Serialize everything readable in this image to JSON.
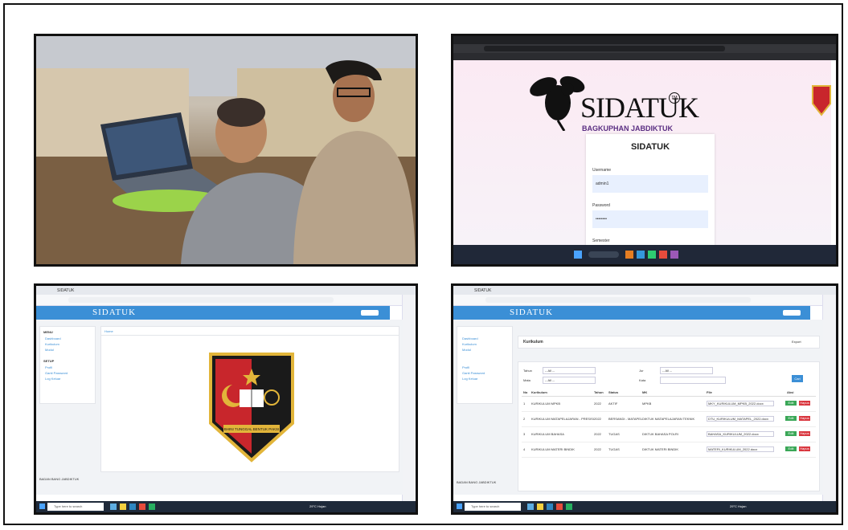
{
  "panel2": {
    "logo_text": "SIDATUK",
    "logo_tm": "TM",
    "tagline": "BAGKUPHAN JABDIKTUK",
    "login_title": "SIDATUK",
    "username_label": "Username",
    "username_value": "admin1",
    "password_label": "Password",
    "password_value": "••••••••",
    "extra_label": "Semester"
  },
  "panel3": {
    "tab_label": "SIDATUK",
    "brand": "SIDATUK",
    "menu_heading": "MENU",
    "menu_items": [
      "Dashboard",
      "Kurikulum",
      "Modul"
    ],
    "setup_heading": "SETUP",
    "setup_items": [
      "Profil",
      "Ganti Password",
      "Log Keluar"
    ],
    "breadcrumb": "Home",
    "emblem_banner": "BHINI TUNGGAL BENTUK PAKSI",
    "footer_text": "BADAN BANG JABDIKTUK",
    "taskbar_search": "Type here to search",
    "weather": "29°C Hujan"
  },
  "panel4": {
    "tab_label": "SIDATUK",
    "brand": "SIDATUK",
    "section_title": "Kurikulum",
    "export_label": "Export",
    "filter_labels": [
      "Tahun",
      "Mata",
      "Jur",
      "Kata"
    ],
    "filter_select": "-- All --",
    "search_button": "Cari",
    "columns": [
      "No",
      "Kurikulum",
      "Tahun",
      "Status",
      "MK",
      "File",
      "Aksi"
    ],
    "rows": [
      [
        "1",
        "KURIKULUM MPKB",
        "2022",
        "AKTIF",
        "MPKB",
        "MKY_KURIKULUM_MPKB_2022.docx"
      ],
      [
        "2",
        "KURIKULUM MATAPELAJARAN - PRESISI",
        "2022",
        "BERSANDI - MATAPEL",
        "DIKTUK MATAPELAJARAN TEKNIK",
        "DTU_KURIKULUM_MATAPEL_2022.docx"
      ],
      [
        "3",
        "KURIKULUM BAHASA",
        "2022",
        "TUGAS",
        "DIKTUK BAHASA POLRI",
        "BAHASA_KURIKULUM_2022.docx"
      ],
      [
        "4",
        "KURIKULUM MATERI BINDIK",
        "2022",
        "TUGAS",
        "DIKTUK MATERI BINDIK",
        "MATERI_KURIKULUM_2022.docx"
      ]
    ],
    "edit_label": "Edit",
    "delete_label": "Hapus",
    "menu_items": [
      "Dashboard",
      "Kurikulum",
      "Modul"
    ],
    "setup_items": [
      "Profil",
      "Ganti Password",
      "Log Keluar"
    ],
    "footer_text": "BADAN BANG JABDIKTUK",
    "taskbar_search": "Type here to search",
    "weather": "29°C Hujan"
  },
  "colors": {
    "app_header": "#3b8fd6",
    "taskbar": "#1f2a3a",
    "emblem_red": "#c8262c",
    "emblem_black": "#1a1a1a",
    "emblem_gold": "#e2b53a"
  }
}
